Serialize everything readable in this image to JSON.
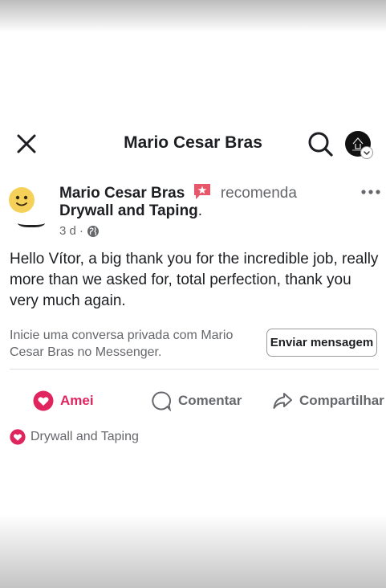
{
  "header": {
    "title": "Mario Cesar Bras",
    "icons": {
      "close": "close-icon",
      "search": "search-icon"
    }
  },
  "post": {
    "author": "Mario Cesar Bras",
    "verb": "recomenda",
    "page": "Drywall and Taping",
    "page_suffix": ".",
    "time": "3 d",
    "separator": "·",
    "privacy_icon": "globe-icon",
    "text": "Hello Vítor, a big thank you for the incredible job, really more than we asked for, total perfection, thank you very much again."
  },
  "messenger": {
    "prompt": "Inicie uma conversa privada com Mario Cesar Bras no Messenger.",
    "button": "Enviar mensagem"
  },
  "actions": {
    "love": "Amei",
    "comment": "Comentar",
    "share": "Compartilhar"
  },
  "reactions": {
    "text": "Drywall and Taping"
  },
  "colors": {
    "love": "#e0245e",
    "recommend_badge": "#e8566a",
    "secondary_text": "#65676b",
    "primary_text": "#1c1e21"
  }
}
